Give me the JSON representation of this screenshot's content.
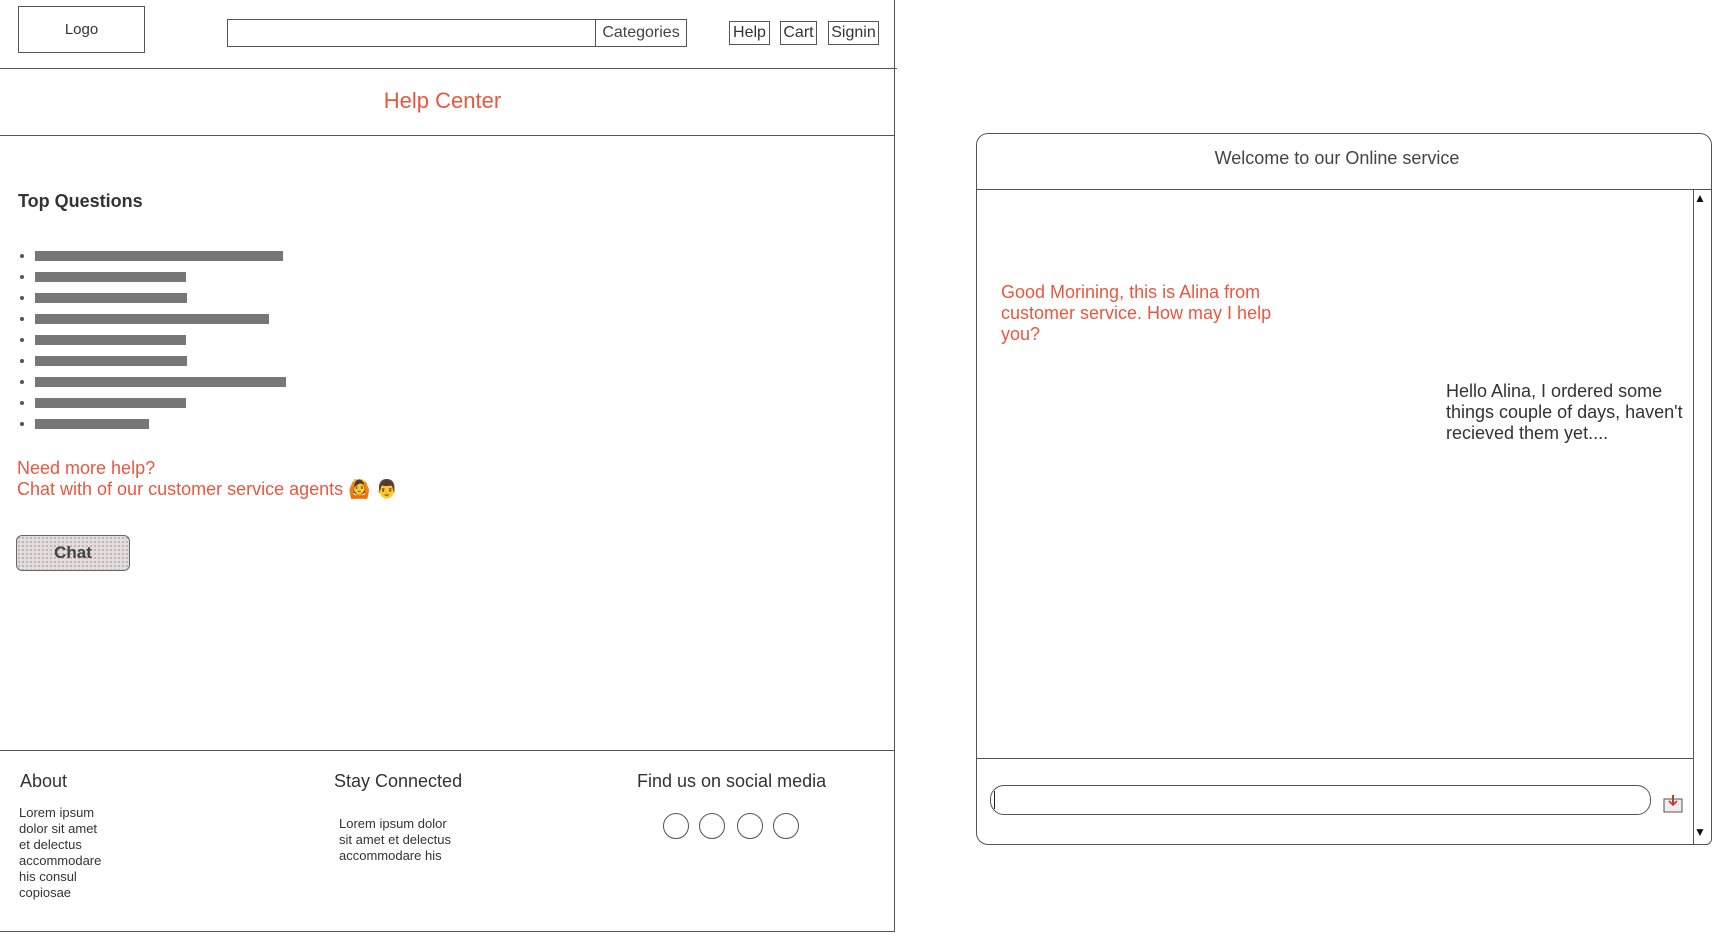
{
  "header": {
    "logo": "Logo",
    "search_placeholder": "",
    "categories": "Categories",
    "nav": {
      "help": "Help",
      "cart": "Cart",
      "signin": "Signin"
    }
  },
  "title": "Help Center",
  "questions": {
    "heading": "Top Questions",
    "count": 9
  },
  "more_help": {
    "line1": "Need more help?",
    "line2": "Chat with of our customer service agents",
    "emoji1": "🙆",
    "emoji2": "👨",
    "button": "Chat"
  },
  "footer": {
    "about": {
      "title": "About",
      "lines": [
        "Lorem ipsum",
        "dolor sit amet",
        "et delectus",
        "accommodare",
        "his consul",
        "copiosae"
      ]
    },
    "connected": {
      "title": "Stay Connected",
      "lines": [
        "Lorem ipsum dolor",
        "sit amet et delectus",
        "accommodare his"
      ]
    },
    "social": {
      "title": "Find us on social media",
      "icon_count": 4
    }
  },
  "chat": {
    "title": "Welcome to our Online service",
    "scroll_up": "▲",
    "scroll_down": "▼",
    "agent_message": "Good Morining, this is Alina from customer service. How may I help you?",
    "user_message": "Hello Alina, I ordered some things couple of days, haven't recieved them yet....",
    "input_value": "",
    "send_icon": "send-icon"
  },
  "colors": {
    "accent": "#e9573f",
    "placeholder_bar": "#777777"
  }
}
